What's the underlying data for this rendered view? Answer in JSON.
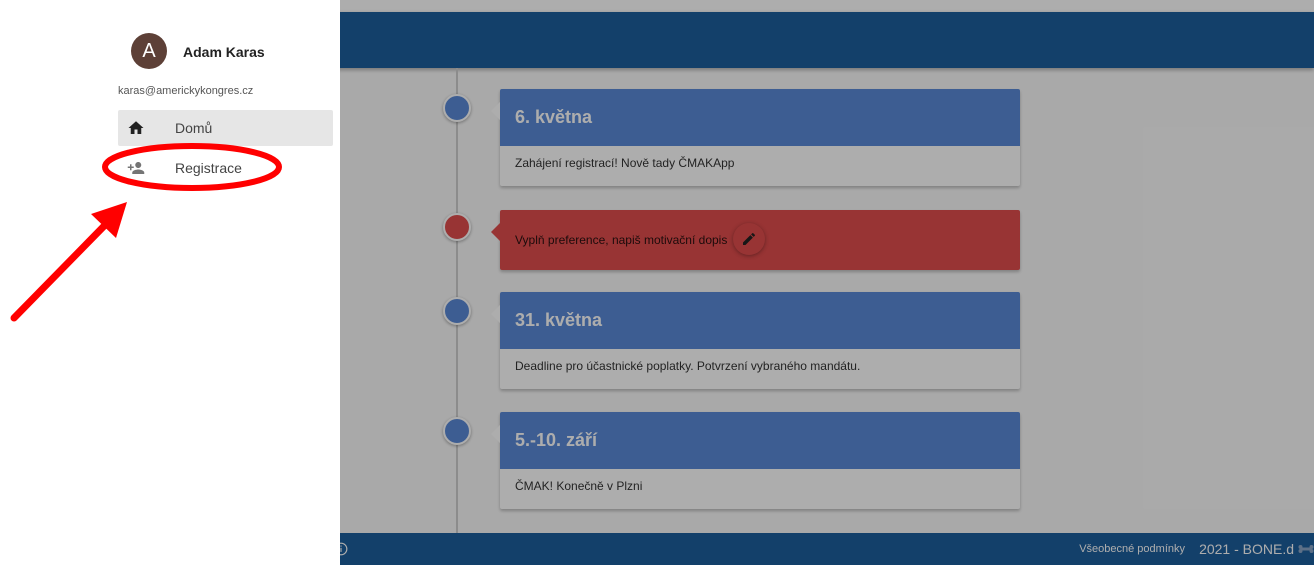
{
  "drawer": {
    "avatar_letter": "A",
    "user_name": "Adam Karas",
    "user_email": "karas@americkykongres.cz",
    "items": [
      {
        "label": "Domů",
        "icon": "home-icon",
        "active": true
      },
      {
        "label": "Registrace",
        "icon": "person-add-icon",
        "active": false
      }
    ]
  },
  "timeline": [
    {
      "date": "6. května",
      "text": "Zahájení registrací! Nově tady ČMAKApp",
      "color": "#5b8ad7"
    },
    {
      "text": "Vyplň preference, napiš motivační dopis",
      "color": "#e04d4d",
      "icon": "edit-icon"
    },
    {
      "date": "31. května",
      "text": "Deadline pro účastnické poplatky. Potvrzení vybraného mandátu.",
      "color": "#5b8ad7"
    },
    {
      "date": "5.-10. září",
      "text": "ČMAK! Konečně v Plzni",
      "color": "#5b8ad7"
    }
  ],
  "footer": {
    "terms": "Všeobecné podmínky",
    "copyright": "2021 - BONE.d",
    "icons": [
      "info-icon",
      "bone-icon"
    ]
  },
  "colors": {
    "app_bar": "#1d5f9d",
    "accent_blue": "#5b8ad7",
    "accent_red": "#e04d4d",
    "annotation": "#ff0000"
  }
}
